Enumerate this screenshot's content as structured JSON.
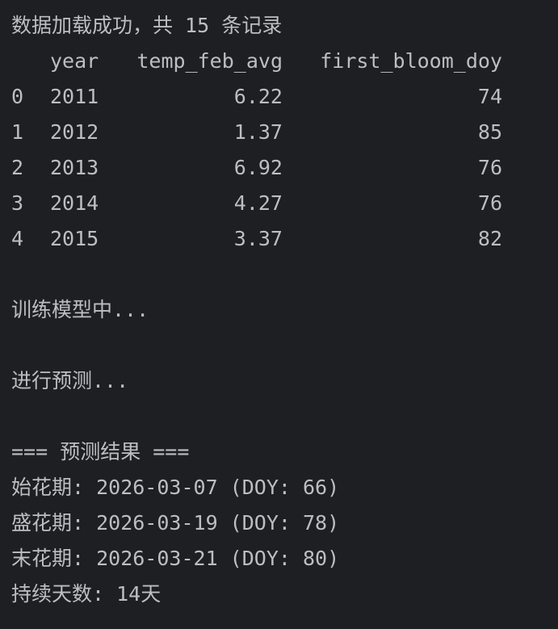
{
  "output": {
    "load_msg": "数据加载成功，共 15 条记录",
    "table": {
      "columns": [
        "year",
        "temp_feb_avg",
        "first_bloom_doy"
      ],
      "rows": [
        {
          "idx": "0",
          "year": "2011",
          "temp": "6.22",
          "doy": "74"
        },
        {
          "idx": "1",
          "year": "2012",
          "temp": "1.37",
          "doy": "85"
        },
        {
          "idx": "2",
          "year": "2013",
          "temp": "6.92",
          "doy": "76"
        },
        {
          "idx": "3",
          "year": "2014",
          "temp": "4.27",
          "doy": "76"
        },
        {
          "idx": "4",
          "year": "2015",
          "temp": "3.37",
          "doy": "82"
        }
      ]
    },
    "training_msg": "训练模型中...",
    "predict_msg": "进行预测...",
    "results_header": "=== 预测结果 ===",
    "start_bloom": "始花期: 2026-03-07 (DOY: 66)",
    "peak_bloom": "盛花期: 2026-03-19 (DOY: 78)",
    "end_bloom": "末花期: 2026-03-21 (DOY: 80)",
    "duration": "持续天数: 14天"
  }
}
